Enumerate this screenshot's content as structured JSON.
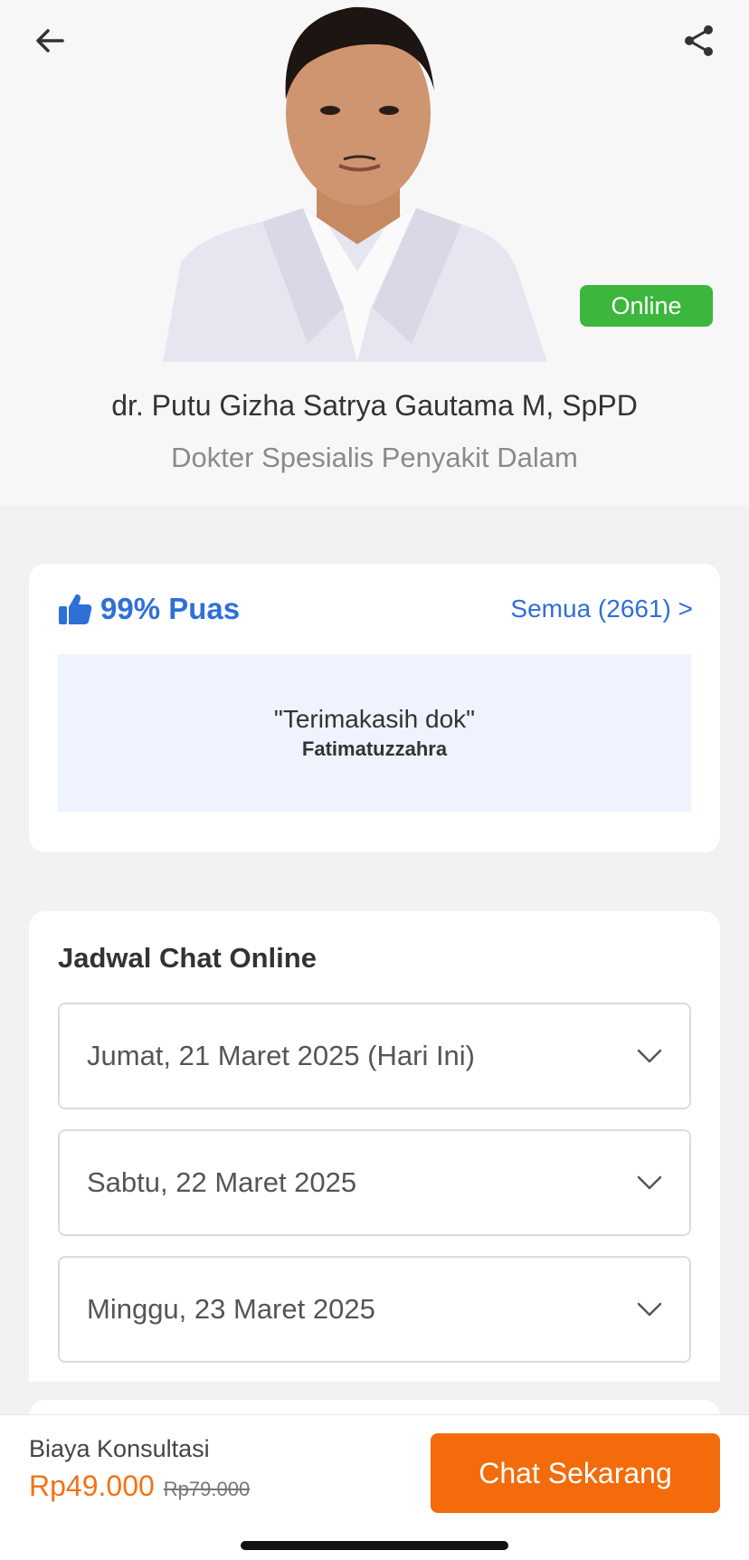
{
  "header": {
    "back_icon": "arrow-left-icon",
    "share_icon": "share-icon"
  },
  "doctor": {
    "status": "Online",
    "name": "dr. Putu Gizha Satrya Gautama M, SpPD",
    "specialty": "Dokter Spesialis Penyakit Dalam",
    "status_color": "#3cb63c"
  },
  "reviews": {
    "icon": "thumbs-up-icon",
    "satisfaction": "99% Puas",
    "see_all": "Semua (2661) >",
    "quote": "\"Terimakasih dok\"",
    "author": "Fatimatuzzahra",
    "accent_color": "#2f6fd8"
  },
  "schedule": {
    "title": "Jadwal Chat Online",
    "days": [
      {
        "label": "Jumat, 21 Maret 2025 (Hari Ini)"
      },
      {
        "label": "Sabtu, 22 Maret 2025"
      },
      {
        "label": "Minggu, 23 Maret 2025"
      }
    ],
    "expand_icon": "chevron-down-icon"
  },
  "footer": {
    "fee_label": "Biaya Konsultasi",
    "price": "Rp49.000",
    "original_price": "Rp79.000",
    "cta": "Chat Sekarang",
    "cta_color": "#f36b0a"
  }
}
